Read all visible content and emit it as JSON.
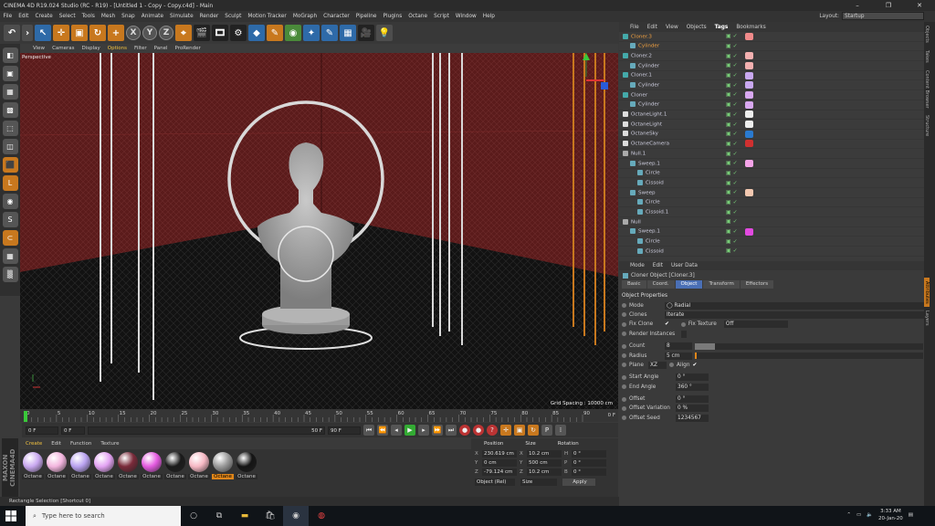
{
  "window": {
    "title": "CINEMA 4D R19.024 Studio (RC - R19) - [Untitled 1 - Copy - Copy.c4d] - Main",
    "min": "–",
    "max": "❐",
    "close": "✕"
  },
  "menu": {
    "items": [
      "File",
      "Edit",
      "Create",
      "Select",
      "Tools",
      "Mesh",
      "Snap",
      "Animate",
      "Simulate",
      "Render",
      "Sculpt",
      "Motion Tracker",
      "MoGraph",
      "Character",
      "Pipeline",
      "Plugins",
      "Octane",
      "Script",
      "Window",
      "Help"
    ],
    "layout_label": "Layout:",
    "layout_value": "Startup"
  },
  "viewport": {
    "menu": [
      "View",
      "Cameras",
      "Display",
      "Options",
      "Filter",
      "Panel",
      "ProRender"
    ],
    "camera_label": "Perspective",
    "grid_spacing": "Grid Spacing : 10000 cm"
  },
  "timeline": {
    "ticks": [
      "0",
      "5",
      "10",
      "15",
      "20",
      "25",
      "30",
      "35",
      "40",
      "45",
      "50",
      "55",
      "60",
      "65",
      "70",
      "75",
      "80",
      "85",
      "90"
    ],
    "end_label": "0 F",
    "start_frame": "0 F",
    "current_frame": "0 F",
    "min_frame": "50 F",
    "max_frame": "90 F"
  },
  "materials": {
    "menu": [
      "Create",
      "Edit",
      "Function",
      "Texture"
    ],
    "items": [
      {
        "label": "Octane",
        "color": "#c9a8f0"
      },
      {
        "label": "Octane",
        "color": "#f3b5de"
      },
      {
        "label": "Octane",
        "color": "#b9a2f0"
      },
      {
        "label": "Octane",
        "color": "#e3a3f3"
      },
      {
        "label": "Octane",
        "color": "#7a2a3a"
      },
      {
        "label": "Octane",
        "color": "#e45ae0"
      },
      {
        "label": "Octane",
        "color": "#1a1a1a"
      },
      {
        "label": "Octane",
        "color": "#f6b8c4"
      },
      {
        "label": "Octane",
        "color": "#9a9a9a",
        "selected": true
      },
      {
        "label": "Octane",
        "color": "#141414"
      }
    ]
  },
  "coords": {
    "headers": [
      "Position",
      "Size",
      "Rotation"
    ],
    "rows": [
      {
        "k": "X",
        "pos": "230.619 cm",
        "sk": "X",
        "size": "10.2 cm",
        "rk": "H",
        "rot": "0 °"
      },
      {
        "k": "Y",
        "pos": "0 cm",
        "sk": "Y",
        "size": "500 cm",
        "rk": "P",
        "rot": "0 °"
      },
      {
        "k": "Z",
        "pos": "-79.124 cm",
        "sk": "Z",
        "size": "10.2 cm",
        "rk": "B",
        "rot": "0 °"
      }
    ],
    "mode": "Object (Rel)",
    "size_mode": "Size",
    "apply": "Apply"
  },
  "status": "Rectangle Selection [Shortcut 0]",
  "objects": {
    "menu": [
      "File",
      "Edit",
      "View",
      "Objects",
      "Tags",
      "Bookmarks"
    ],
    "rows": [
      {
        "name": "Cloner.3",
        "indent": 0,
        "sel": true,
        "tag": "#f08a8a"
      },
      {
        "name": "Cylinder",
        "indent": 1,
        "sel": true,
        "tag": ""
      },
      {
        "name": "Cloner.2",
        "indent": 0,
        "tag": "#f3b0b0"
      },
      {
        "name": "Cylinder",
        "indent": 1,
        "tag": "#f3b0b0"
      },
      {
        "name": "Cloner.1",
        "indent": 0,
        "tag": "#c9a8f0"
      },
      {
        "name": "Cylinder",
        "indent": 1,
        "tag": "#c9a8f0"
      },
      {
        "name": "Cloner",
        "indent": 0,
        "tag": "#d8a8f0"
      },
      {
        "name": "Cylinder",
        "indent": 1,
        "tag": "#d8a8f0"
      },
      {
        "name": "OctaneLight.1",
        "indent": 0,
        "tag": "#eeeeee"
      },
      {
        "name": "OctaneLight",
        "indent": 0,
        "tag": "#eeeeee"
      },
      {
        "name": "OctaneSky",
        "indent": 0,
        "tag": "#2a7ad0"
      },
      {
        "name": "OctaneCamera",
        "indent": 0,
        "tag": "#d03030"
      },
      {
        "name": "Null.1",
        "indent": 0,
        "tag": ""
      },
      {
        "name": "Sweep.1",
        "indent": 1,
        "tag": "#f5a3e8"
      },
      {
        "name": "Circle",
        "indent": 2,
        "tag": ""
      },
      {
        "name": "Cissoid",
        "indent": 2,
        "tag": ""
      },
      {
        "name": "Sweep",
        "indent": 1,
        "tag": "#f3c8b0"
      },
      {
        "name": "Circle",
        "indent": 2,
        "tag": ""
      },
      {
        "name": "Cissoid.1",
        "indent": 2,
        "tag": ""
      },
      {
        "name": "Null",
        "indent": 0,
        "tag": ""
      },
      {
        "name": "Sweep.1",
        "indent": 1,
        "tag": "#e24ae0"
      },
      {
        "name": "Circle",
        "indent": 2,
        "tag": ""
      },
      {
        "name": "Cissoid",
        "indent": 2,
        "tag": ""
      }
    ]
  },
  "attributes": {
    "menu": [
      "Mode",
      "Edit",
      "User Data"
    ],
    "title": "Cloner Object [Cloner.3]",
    "tabs": [
      "Basic",
      "Coord.",
      "Object",
      "Transform",
      "Effectors"
    ],
    "active_tab": "Object",
    "section": "Object Properties",
    "mode_label": "Mode",
    "mode_value": "◯ Radial",
    "clones_label": "Clones",
    "clones_value": "Iterate",
    "fix_clone": "Fix Clone",
    "fix_texture": "Fix Texture",
    "fix_texture_value": "Off",
    "render_instances": "Render Instances",
    "count_label": "Count",
    "count_value": "8",
    "radius_label": "Radius",
    "radius_value": "5 cm",
    "plane_label": "Plane",
    "plane_value": "XZ",
    "align_label": "Align",
    "start_label": "Start Angle",
    "start_value": "0 °",
    "end_label": "End Angle",
    "end_value": "360 °",
    "offset_label": "Offset",
    "offset_value": "0 °",
    "offvar_label": "Offset Variation",
    "offvar_value": "0 %",
    "seed_label": "Offset Seed",
    "seed_value": "1234567"
  },
  "right_strip": [
    "Objects",
    "Takes",
    "Content Browser",
    "Structure",
    "Attributes",
    "Layers"
  ],
  "taskbar": {
    "search_placeholder": "Type here to search",
    "time": "3:33 AM",
    "date": "20-Jan-20"
  }
}
